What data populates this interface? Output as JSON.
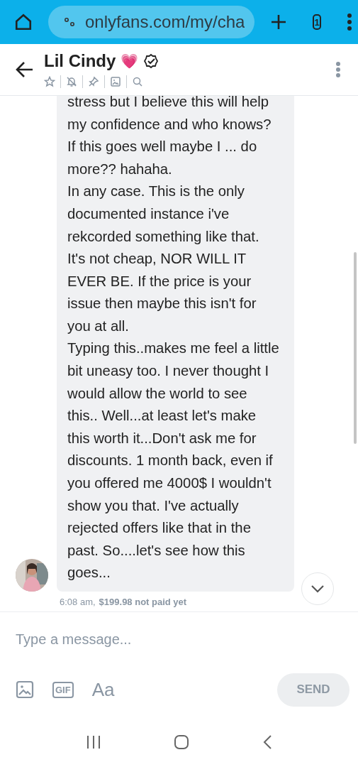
{
  "browser": {
    "url": "onlyfans.com/my/cha",
    "tab_count": "1"
  },
  "header": {
    "name": "Lil Cindy",
    "emoji": "💗",
    "verified": true
  },
  "messages": [
    {
      "paragraphs": [
        "stress but I believe this will help my confidence and who knows? If this goes well maybe I ... do more?? hahaha.",
        "In any case. This is the only documented instance i've rekcorded something like that. It's not cheap, NOR WILL IT EVER BE. If the price is your issue then maybe this isn't for you at all.",
        "Typing this..makes me feel a little bit uneasy too. I never thought I would allow the world to see this.. Well...at least let's make this worth it...Don't ask me for discounts. 1 month back, even if you offered me 4000$ I wouldn't show you that. I've actually rejected offers like that in the past. So....let's see how this goes..."
      ],
      "time": "6:08 am,",
      "price": "$199.98 not paid yet"
    }
  ],
  "composer": {
    "placeholder": "Type a message...",
    "gif_label": "GIF",
    "format_label": "Aa",
    "send": "SEND",
    "send_disabled": true
  }
}
